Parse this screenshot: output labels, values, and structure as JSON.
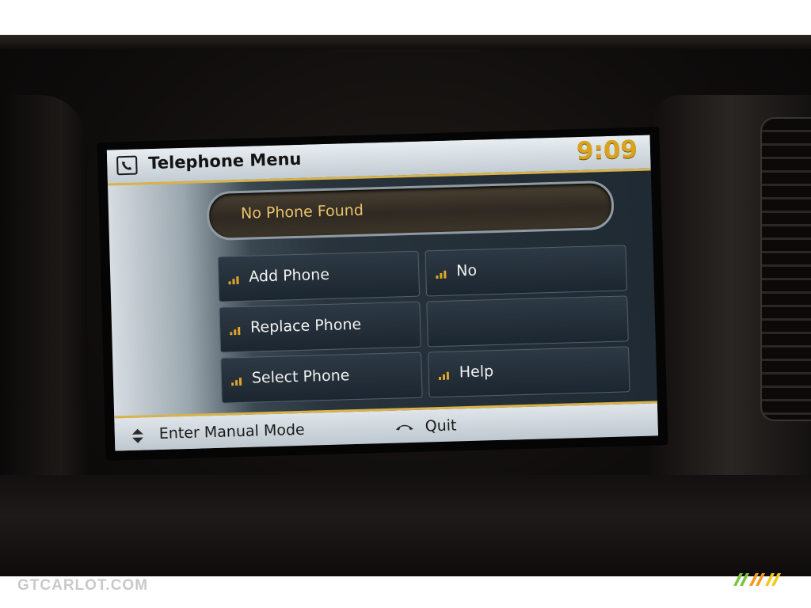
{
  "header": {
    "title": "Telephone Menu",
    "clock": "9:09"
  },
  "status": {
    "text": "No Phone Found"
  },
  "menu": {
    "left": [
      {
        "label": "Add Phone"
      },
      {
        "label": "Replace Phone"
      },
      {
        "label": "Select Phone"
      }
    ],
    "right": [
      {
        "label": "No"
      },
      {
        "label": ""
      },
      {
        "label": "Help"
      }
    ]
  },
  "footer": {
    "manual_label": "Enter Manual Mode",
    "quit_label": "Quit"
  },
  "watermark": {
    "text": "GTCARLOT.COM"
  },
  "icons": {
    "header": "phone-icon",
    "menu_item": "signal-icon",
    "manual": "up-down-icon",
    "quit": "hang-up-icon"
  },
  "colors": {
    "accent_gold": "#d8b24a",
    "clock": "#d9a31d",
    "status_text": "#e9c36a",
    "menu_text": "#f1f1f1"
  }
}
